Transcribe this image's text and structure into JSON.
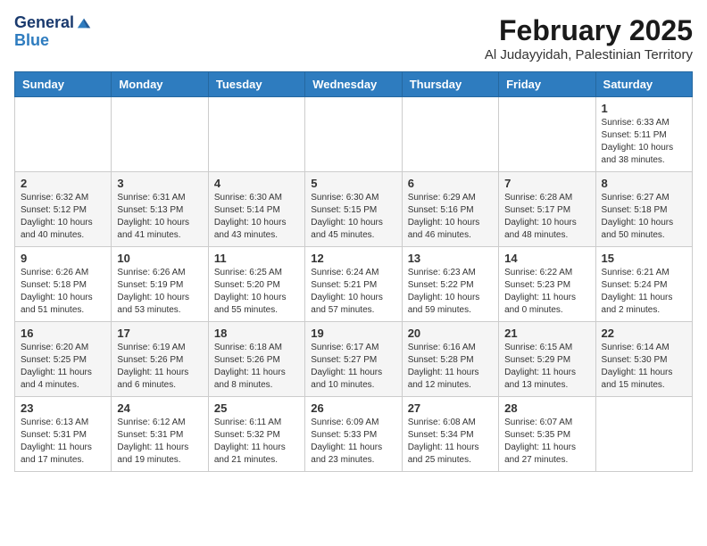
{
  "logo": {
    "line1": "General",
    "line2": "Blue"
  },
  "header": {
    "title": "February 2025",
    "subtitle": "Al Judayyidah, Palestinian Territory"
  },
  "weekdays": [
    "Sunday",
    "Monday",
    "Tuesday",
    "Wednesday",
    "Thursday",
    "Friday",
    "Saturday"
  ],
  "weeks": [
    [
      {
        "day": "",
        "info": ""
      },
      {
        "day": "",
        "info": ""
      },
      {
        "day": "",
        "info": ""
      },
      {
        "day": "",
        "info": ""
      },
      {
        "day": "",
        "info": ""
      },
      {
        "day": "",
        "info": ""
      },
      {
        "day": "1",
        "info": "Sunrise: 6:33 AM\nSunset: 5:11 PM\nDaylight: 10 hours\nand 38 minutes."
      }
    ],
    [
      {
        "day": "2",
        "info": "Sunrise: 6:32 AM\nSunset: 5:12 PM\nDaylight: 10 hours\nand 40 minutes."
      },
      {
        "day": "3",
        "info": "Sunrise: 6:31 AM\nSunset: 5:13 PM\nDaylight: 10 hours\nand 41 minutes."
      },
      {
        "day": "4",
        "info": "Sunrise: 6:30 AM\nSunset: 5:14 PM\nDaylight: 10 hours\nand 43 minutes."
      },
      {
        "day": "5",
        "info": "Sunrise: 6:30 AM\nSunset: 5:15 PM\nDaylight: 10 hours\nand 45 minutes."
      },
      {
        "day": "6",
        "info": "Sunrise: 6:29 AM\nSunset: 5:16 PM\nDaylight: 10 hours\nand 46 minutes."
      },
      {
        "day": "7",
        "info": "Sunrise: 6:28 AM\nSunset: 5:17 PM\nDaylight: 10 hours\nand 48 minutes."
      },
      {
        "day": "8",
        "info": "Sunrise: 6:27 AM\nSunset: 5:18 PM\nDaylight: 10 hours\nand 50 minutes."
      }
    ],
    [
      {
        "day": "9",
        "info": "Sunrise: 6:26 AM\nSunset: 5:18 PM\nDaylight: 10 hours\nand 51 minutes."
      },
      {
        "day": "10",
        "info": "Sunrise: 6:26 AM\nSunset: 5:19 PM\nDaylight: 10 hours\nand 53 minutes."
      },
      {
        "day": "11",
        "info": "Sunrise: 6:25 AM\nSunset: 5:20 PM\nDaylight: 10 hours\nand 55 minutes."
      },
      {
        "day": "12",
        "info": "Sunrise: 6:24 AM\nSunset: 5:21 PM\nDaylight: 10 hours\nand 57 minutes."
      },
      {
        "day": "13",
        "info": "Sunrise: 6:23 AM\nSunset: 5:22 PM\nDaylight: 10 hours\nand 59 minutes."
      },
      {
        "day": "14",
        "info": "Sunrise: 6:22 AM\nSunset: 5:23 PM\nDaylight: 11 hours\nand 0 minutes."
      },
      {
        "day": "15",
        "info": "Sunrise: 6:21 AM\nSunset: 5:24 PM\nDaylight: 11 hours\nand 2 minutes."
      }
    ],
    [
      {
        "day": "16",
        "info": "Sunrise: 6:20 AM\nSunset: 5:25 PM\nDaylight: 11 hours\nand 4 minutes."
      },
      {
        "day": "17",
        "info": "Sunrise: 6:19 AM\nSunset: 5:26 PM\nDaylight: 11 hours\nand 6 minutes."
      },
      {
        "day": "18",
        "info": "Sunrise: 6:18 AM\nSunset: 5:26 PM\nDaylight: 11 hours\nand 8 minutes."
      },
      {
        "day": "19",
        "info": "Sunrise: 6:17 AM\nSunset: 5:27 PM\nDaylight: 11 hours\nand 10 minutes."
      },
      {
        "day": "20",
        "info": "Sunrise: 6:16 AM\nSunset: 5:28 PM\nDaylight: 11 hours\nand 12 minutes."
      },
      {
        "day": "21",
        "info": "Sunrise: 6:15 AM\nSunset: 5:29 PM\nDaylight: 11 hours\nand 13 minutes."
      },
      {
        "day": "22",
        "info": "Sunrise: 6:14 AM\nSunset: 5:30 PM\nDaylight: 11 hours\nand 15 minutes."
      }
    ],
    [
      {
        "day": "23",
        "info": "Sunrise: 6:13 AM\nSunset: 5:31 PM\nDaylight: 11 hours\nand 17 minutes."
      },
      {
        "day": "24",
        "info": "Sunrise: 6:12 AM\nSunset: 5:31 PM\nDaylight: 11 hours\nand 19 minutes."
      },
      {
        "day": "25",
        "info": "Sunrise: 6:11 AM\nSunset: 5:32 PM\nDaylight: 11 hours\nand 21 minutes."
      },
      {
        "day": "26",
        "info": "Sunrise: 6:09 AM\nSunset: 5:33 PM\nDaylight: 11 hours\nand 23 minutes."
      },
      {
        "day": "27",
        "info": "Sunrise: 6:08 AM\nSunset: 5:34 PM\nDaylight: 11 hours\nand 25 minutes."
      },
      {
        "day": "28",
        "info": "Sunrise: 6:07 AM\nSunset: 5:35 PM\nDaylight: 11 hours\nand 27 minutes."
      },
      {
        "day": "",
        "info": ""
      }
    ]
  ]
}
